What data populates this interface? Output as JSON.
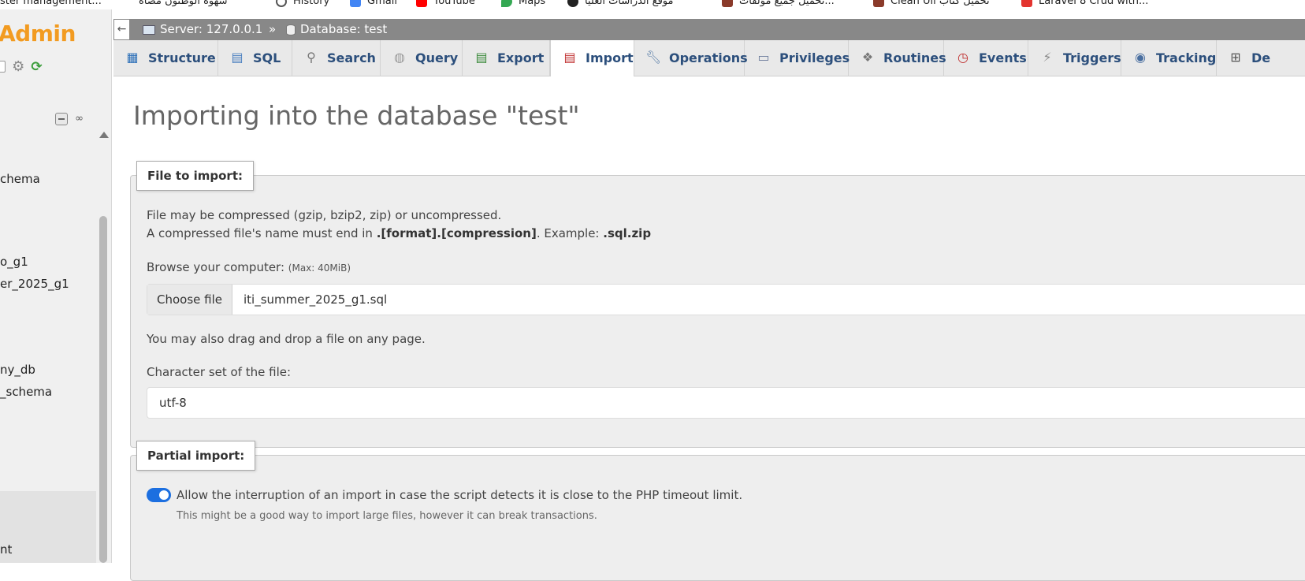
{
  "bookmarks": [
    {
      "label": "ster management...",
      "icon": "page-icon",
      "color": "#777777"
    },
    {
      "label": "شهوة الوطنون مصاه",
      "icon": "page-icon",
      "color": "#777777"
    },
    {
      "label": "History",
      "icon": "history-icon",
      "color": "#555555"
    },
    {
      "label": "Gmail",
      "icon": "gmail-icon",
      "color": "#d93025"
    },
    {
      "label": "YouTube",
      "icon": "youtube-icon",
      "color": "#ff0000"
    },
    {
      "label": "Maps",
      "icon": "maps-icon",
      "color": "#34a853"
    },
    {
      "label": "موقع الدراسات العليا",
      "icon": "page-icon",
      "color": "#333333"
    },
    {
      "label": "تحميل جميع مؤلفات...",
      "icon": "page-icon",
      "color": "#8a3a2a"
    },
    {
      "label": "Clean Ull تحميل كتاب",
      "icon": "page-icon",
      "color": "#8a3a2a"
    },
    {
      "label": "Laravel 8 Crud with...",
      "icon": "laravel-icon",
      "color": "#e3342f"
    }
  ],
  "nav": {
    "logo": "Admin",
    "db_items": [
      "chema",
      "o_g1",
      "er_2025_g1",
      "ny_db",
      "_schema",
      "nt"
    ]
  },
  "breadcrumb": {
    "server": "Server: 127.0.0.1",
    "separator": "»",
    "database": "Database: test"
  },
  "tabs": [
    {
      "label": "Structure",
      "icon": "structure-icon"
    },
    {
      "label": "SQL",
      "icon": "sql-icon"
    },
    {
      "label": "Search",
      "icon": "search-icon"
    },
    {
      "label": "Query",
      "icon": "query-icon"
    },
    {
      "label": "Export",
      "icon": "export-icon"
    },
    {
      "label": "Import",
      "icon": "import-icon",
      "active": true
    },
    {
      "label": "Operations",
      "icon": "wrench-icon"
    },
    {
      "label": "Privileges",
      "icon": "privileges-icon"
    },
    {
      "label": "Routines",
      "icon": "routines-icon"
    },
    {
      "label": "Events",
      "icon": "events-icon"
    },
    {
      "label": "Triggers",
      "icon": "triggers-icon"
    },
    {
      "label": "Tracking",
      "icon": "eye-icon"
    },
    {
      "label": "De",
      "icon": "designer-icon"
    }
  ],
  "page": {
    "title": "Importing into the database \"test\""
  },
  "file_import": {
    "legend": "File to import:",
    "line1": "File may be compressed (gzip, bzip2, zip) or uncompressed.",
    "line2_pre": "A compressed file's name must end in ",
    "line2_bold": ".[format].[compression]",
    "line2_mid": ". Example: ",
    "line2_example": ".sql.zip",
    "browse_label": "Browse your computer:",
    "max_size": "(Max: 40MiB)",
    "choose_button": "Choose file",
    "file_name": "iti_summer_2025_g1.sql",
    "drag_text": "You may also drag and drop a file on any page.",
    "charset_label": "Character set of the file:",
    "charset_value": "utf-8"
  },
  "partial_import": {
    "legend": "Partial import:",
    "allow_interrupt_label": "Allow the interruption of an import in case the script detects it is close to the PHP timeout limit.",
    "allow_interrupt_checked": true,
    "hint": "This might be a good way to import large files, however it can break transactions."
  },
  "colors": {
    "accent": "#1c6fe0",
    "tab_text": "#2c4f7c",
    "logo": "#f29b21"
  }
}
